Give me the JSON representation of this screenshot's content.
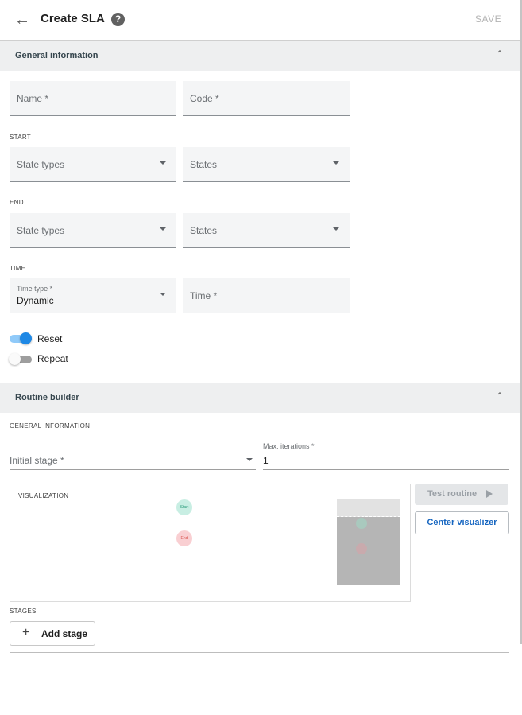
{
  "header": {
    "title": "Create SLA",
    "save_label": "SAVE",
    "back_icon": "arrow-left-icon",
    "help_glyph": "?"
  },
  "general_section": {
    "label": "General information",
    "name_placeholder": "Name *",
    "code_placeholder": "Code *",
    "start_caption": "START",
    "start_state_types": "State types",
    "start_states": "States",
    "end_caption": "END",
    "end_state_types": "State types",
    "end_states": "States",
    "time_caption": "TIME",
    "time_type_label": "Time type *",
    "time_type_value": "Dynamic",
    "time_placeholder": "Time *",
    "reset_label": "Reset",
    "reset_on": true,
    "repeat_label": "Repeat",
    "repeat_on": false
  },
  "routine_section": {
    "label": "Routine builder",
    "general_caption": "GENERAL INFORMATION",
    "initial_stage_placeholder": "Initial stage *",
    "max_iterations_label": "Max. iterations *",
    "max_iterations_value": "1",
    "visualization_caption": "VISUALIZATION",
    "start_node": "Start",
    "end_node": "End",
    "test_routine_label": "Test routine",
    "center_visualizer_label": "Center visualizer",
    "stages_caption": "STAGES",
    "add_stage_label": "Add stage"
  },
  "colors": {
    "accent": "#1e88e5",
    "start_node": "#c8eee3",
    "end_node": "#f9cfd2"
  }
}
